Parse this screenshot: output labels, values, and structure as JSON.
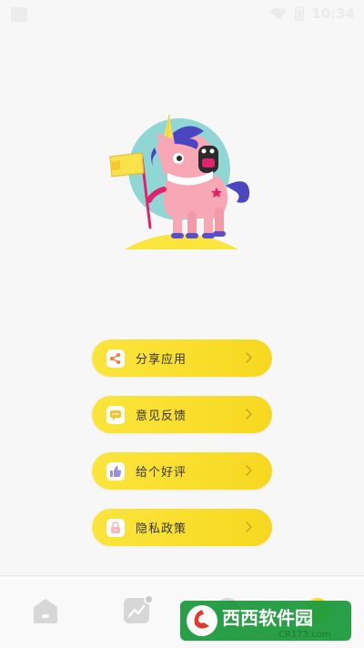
{
  "status_bar": {
    "time": "10:34",
    "icons": [
      "wifi-icon",
      "battery-icon"
    ]
  },
  "menu": {
    "items": [
      {
        "label": "分享应用",
        "icon": "share-icon",
        "icon_color": "#f07a3a"
      },
      {
        "label": "意见反馈",
        "icon": "chat-bubble-icon",
        "icon_color": "#f2c52a"
      },
      {
        "label": "给个好评",
        "icon": "thumbs-up-icon",
        "icon_color": "#9b8be8"
      },
      {
        "label": "隐私政策",
        "icon": "lock-icon",
        "icon_color": "#f7b6c2"
      }
    ]
  },
  "bottom_nav": {
    "items": [
      {
        "icon": "home-icon"
      },
      {
        "icon": "stats-chart-icon"
      },
      {
        "icon": "message-icon"
      },
      {
        "icon": "profile-icon",
        "active": true
      }
    ]
  },
  "watermark": {
    "brand": "西西软件园",
    "url": "CR173.com"
  },
  "colors": {
    "accent_yellow": "#f9dc2c",
    "background": "#f7f7f7",
    "text": "#333333"
  }
}
